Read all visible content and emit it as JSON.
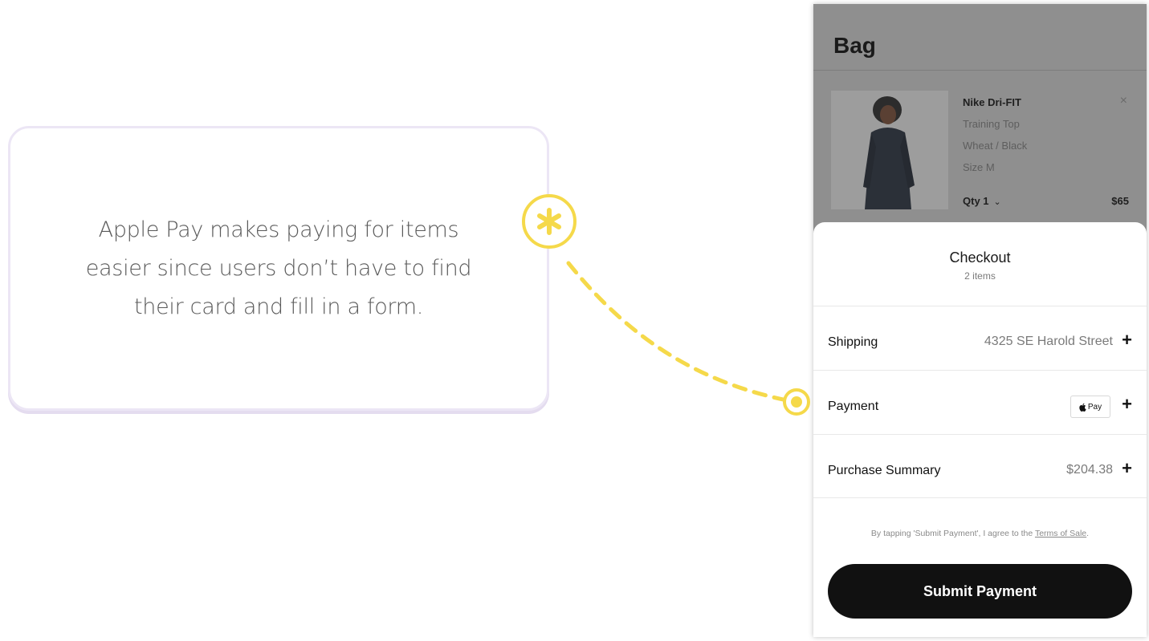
{
  "annotation": {
    "text": "Apple Pay makes paying for items easier since users don’t have to find their card and fill in a form.",
    "marker_icon": "asterisk-icon",
    "accent_color": "#f5d94a"
  },
  "bag": {
    "title": "Bag",
    "item": {
      "name": "Nike Dri-FIT",
      "line1": "Training Top",
      "line2": "Wheat / Black",
      "line3": "Size M",
      "qty_label": "Qty 1",
      "price": "$65",
      "remove_icon": "close-icon"
    }
  },
  "checkout": {
    "title": "Checkout",
    "subtitle": "2 items",
    "rows": {
      "shipping": {
        "label": "Shipping",
        "value": "4325 SE Harold Street"
      },
      "payment": {
        "label": "Payment",
        "value": "Pay"
      },
      "summary": {
        "label": "Purchase Summary",
        "value": "$204.38"
      }
    },
    "plus_symbol": "+",
    "legal_prefix": "By tapping 'Submit Payment', I agree to the ",
    "legal_link": "Terms of Sale",
    "legal_suffix": ".",
    "submit_label": "Submit Payment"
  }
}
